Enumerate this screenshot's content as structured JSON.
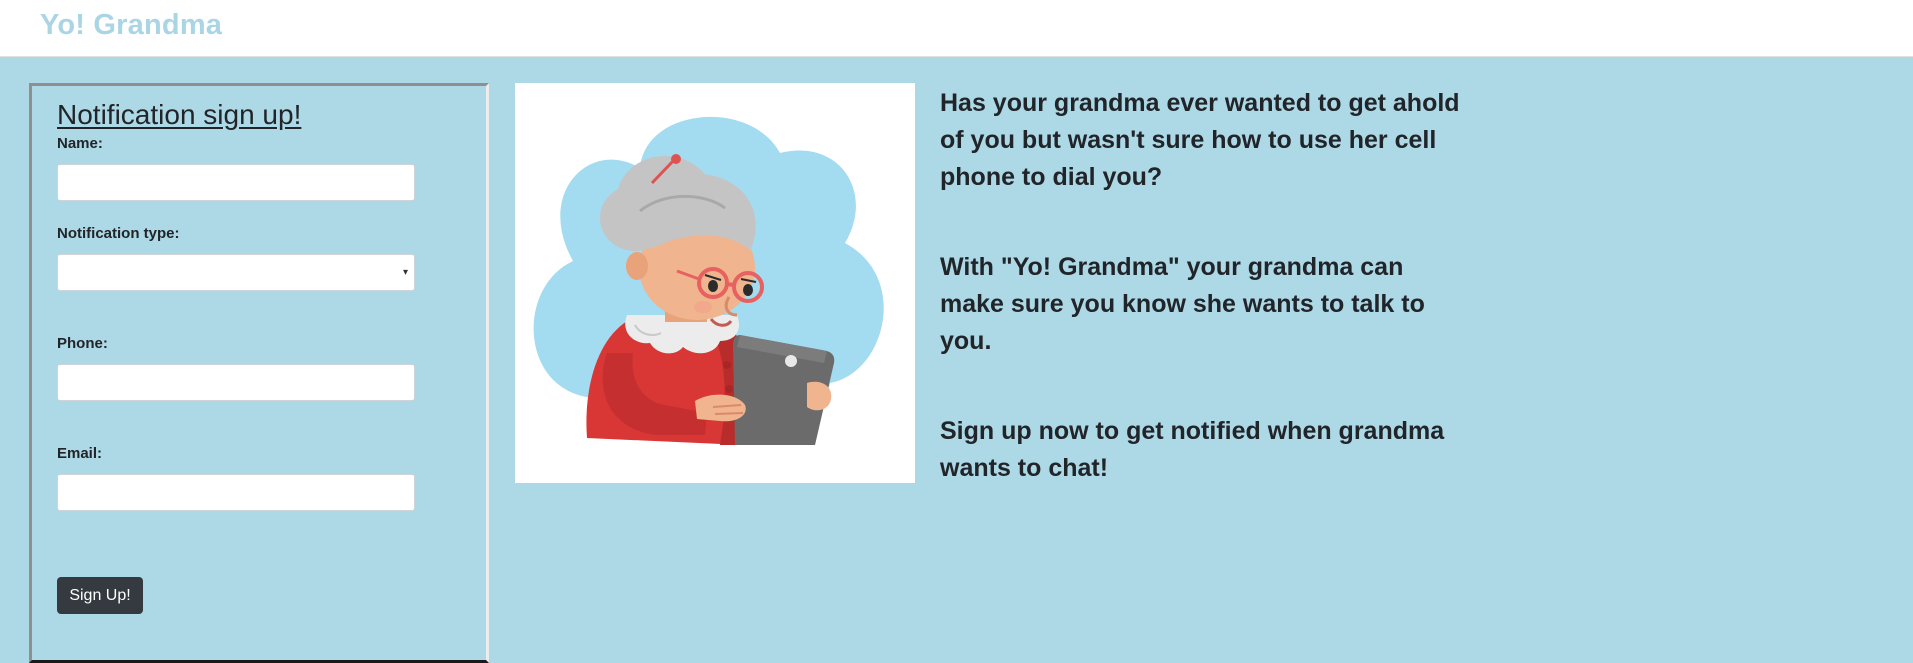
{
  "app": {
    "brand": "Yo! Grandma"
  },
  "signup": {
    "title": "Notification sign up!",
    "name_label": "Name:",
    "name_value": "",
    "type_label": "Notification type:",
    "type_selected": "",
    "phone_label": "Phone:",
    "phone_value": "",
    "email_label": "Email:",
    "email_value": "",
    "submit_label": "Sign Up!"
  },
  "illustration": {
    "subject": "grandma-with-tablet"
  },
  "copy": {
    "paragraphs": [
      "Has your grandma ever wanted to get ahold of you but wasn't sure how to use her cell phone to dial you?",
      "With \"Yo! Grandma\" your grandma can make sure you know she wants to talk to you.",
      "Sign up now to get notified when grandma wants to chat!"
    ]
  },
  "colors": {
    "page_background": "#add8e6",
    "brand_text": "#a9d5e4",
    "button_background": "#343a40",
    "cloud": "#a3dbf0",
    "sweater": "#d93636",
    "hair": "#c4c4c4",
    "skin": "#f0b48e",
    "tablet": "#6b6b6b"
  },
  "icons": {
    "select_caret": "▾"
  }
}
